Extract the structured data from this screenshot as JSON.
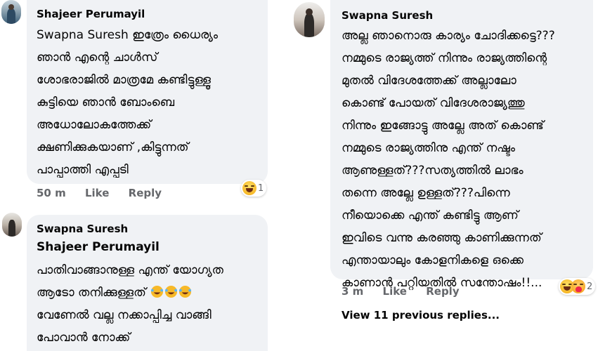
{
  "comment1": {
    "author": "Shajeer Perumayil",
    "lines": [
      "Swapna Suresh ഇത്രേം ധൈര്യം",
      "ഞാൻ എന്റെ ചാൾസ്",
      "ശോഭരാജിൽ മാത്രമേ കണ്ടിട്ടുള്ളൂ",
      "കുട്ടിയെ ഞാൻ ബോംബെ",
      "അധോലോകത്തേക്ക്",
      "ക്ഷണിക്കുകയാണ് ,കിട്ടുന്നത്",
      "പാപ്പാത്തി എപ്പടി"
    ],
    "time": "50 m",
    "like": "Like",
    "reply": "Reply",
    "reaction_count": "1"
  },
  "comment2": {
    "author": "Swapna Suresh",
    "mention": "Shajeer Perumayil",
    "lines": [
      "പാതിവാങ്ങാനുള്ള എന്ത് യോഗ്യത",
      "ആടോ തനിക്കുള്ളത്",
      "വേണേൽ വല്ല നക്കാപ്പിച്ച വാങ്ങി",
      "പോവാൻ നോക്ക്"
    ]
  },
  "comment3": {
    "author": "Swapna Suresh",
    "lines": [
      "അല്ല ഞാനൊരു കാര്യം ചോദിക്കട്ടെ???",
      "നമ്മുടെ രാജ്യത്ത് നിന്നും രാജ്യത്തിന്റെ",
      "മുതൽ വിദേശത്തേക്ക് അല്ലാലോ",
      "കൊണ്ട് പോയത് വിദേശരാജ്യത്തു",
      "നിന്നും ഇങ്ങോട്ടു അല്ലേ അത് കൊണ്ട്",
      "നമ്മുടെ രാജ്യത്തിനു എന്ത് നഷ്ടം",
      "ആണുള്ളത്???സത്യത്തിൽ ലാഭം",
      "തന്നെ അല്ലേ ഉള്ളത്???പിന്നെ",
      "നീയൊക്കെ എന്ത് കണ്ടിട്ടു ആണ്",
      "ഇവിടെ വന്നു കരഞ്ഞു കാണിക്കുന്നത്",
      "എന്തായാലും കോളനികളെ ഒക്കെ",
      "കാണാൻ പറ്റിയതിൽ സന്തോഷം!!..."
    ],
    "time": "3 m",
    "like": "Like",
    "reply": "Reply",
    "reaction_count": "2"
  },
  "view_previous": "View 11 previous replies...",
  "colors": {
    "bubble": "#f0f2f5",
    "meta": "#65676b",
    "text": "#050505"
  }
}
